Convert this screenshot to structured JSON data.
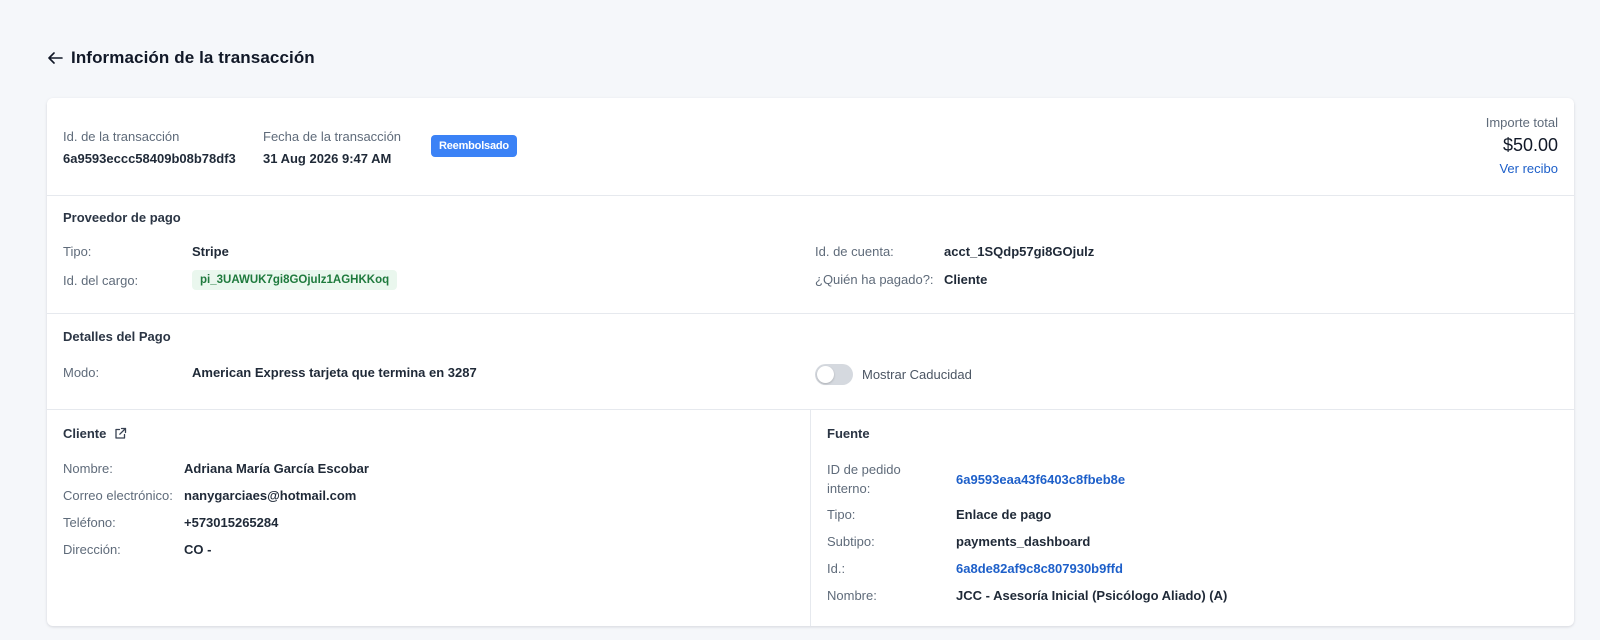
{
  "header": {
    "title": "Información de la transacción"
  },
  "summary": {
    "transaction_id_label": "Id. de la transacción",
    "transaction_id": "6a9593eccc58409b08b78df3",
    "date_label": "Fecha de la transacción",
    "date": "31 Aug 2026 9:47 AM",
    "status": "Reembolsado",
    "total_label": "Importe total",
    "total": "$50.00",
    "receipt_link": "Ver recibo"
  },
  "provider": {
    "title": "Proveedor de pago",
    "type_label": "Tipo:",
    "type": "Stripe",
    "charge_label": "Id. del cargo:",
    "charge_id": "pi_3UAWUK7gi8GOjulz1AGHKKoq",
    "account_label": "Id. de cuenta:",
    "account_id": "acct_1SQdp57gi8GOjulz",
    "payer_label": "¿Quién ha pagado?:",
    "payer": "Cliente"
  },
  "payment": {
    "title": "Detalles del Pago",
    "mode_label": "Modo:",
    "mode": "American Express tarjeta que termina en 3287",
    "toggle_label": "Mostrar Caducidad",
    "toggle_on": false
  },
  "customer": {
    "title": "Cliente",
    "name_label": "Nombre:",
    "name": "Adriana María García Escobar",
    "email_label": "Correo electrónico:",
    "email": "nanygarciaes@hotmail.com",
    "phone_label": "Teléfono:",
    "phone": "+573015265284",
    "address_label": "Dirección:",
    "address": "CO -"
  },
  "source": {
    "title": "Fuente",
    "order_label_line1": "ID de pedido",
    "order_label_line2": "interno:",
    "order_id": "6a9593eaa43f6403c8fbeb8e",
    "type_label": "Tipo:",
    "type": "Enlace de pago",
    "subtype_label": "Subtipo:",
    "subtype": "payments_dashboard",
    "id_label": "Id.:",
    "id": "6a8de82af9c8c807930b9ffd",
    "name_label": "Nombre:",
    "name": "JCC - Asesoría Inicial (Psicólogo Aliado) (A)"
  },
  "colors": {
    "background": "#f5f7fa",
    "badge": "#3b82f6",
    "link": "#1d5fc9",
    "chip_bg": "#eaf7ee",
    "chip_text": "#1f7a3d"
  }
}
